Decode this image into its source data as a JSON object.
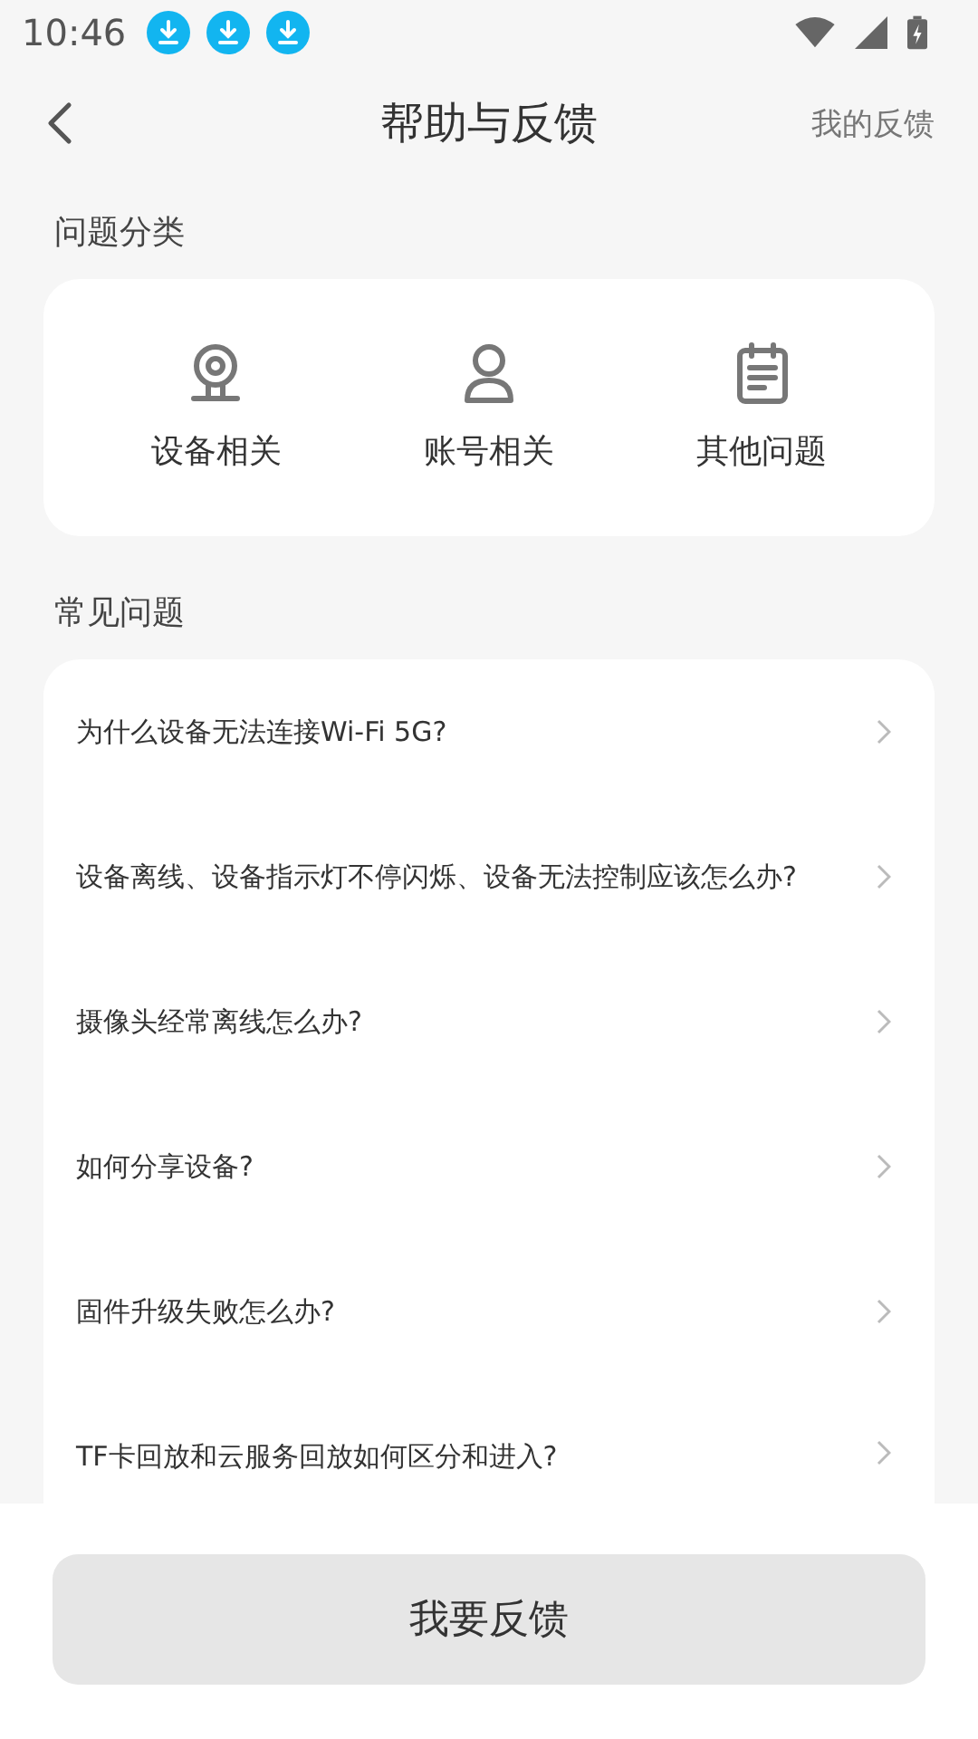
{
  "status_bar": {
    "time": "10:46"
  },
  "header": {
    "title": "帮助与反馈",
    "action": "我的反馈"
  },
  "categories": {
    "title": "问题分类",
    "items": [
      {
        "label": "设备相关"
      },
      {
        "label": "账号相关"
      },
      {
        "label": "其他问题"
      }
    ]
  },
  "faq": {
    "title": "常见问题",
    "items": [
      "为什么设备无法连接Wi-Fi 5G?",
      "设备离线、设备指示灯不停闪烁、设备无法控制应该怎么办?",
      "摄像头经常离线怎么办?",
      "如何分享设备?",
      "固件升级失败怎么办?",
      "TF卡回放和云服务回放如何区分和进入?"
    ]
  },
  "feedback_button": "我要反馈"
}
